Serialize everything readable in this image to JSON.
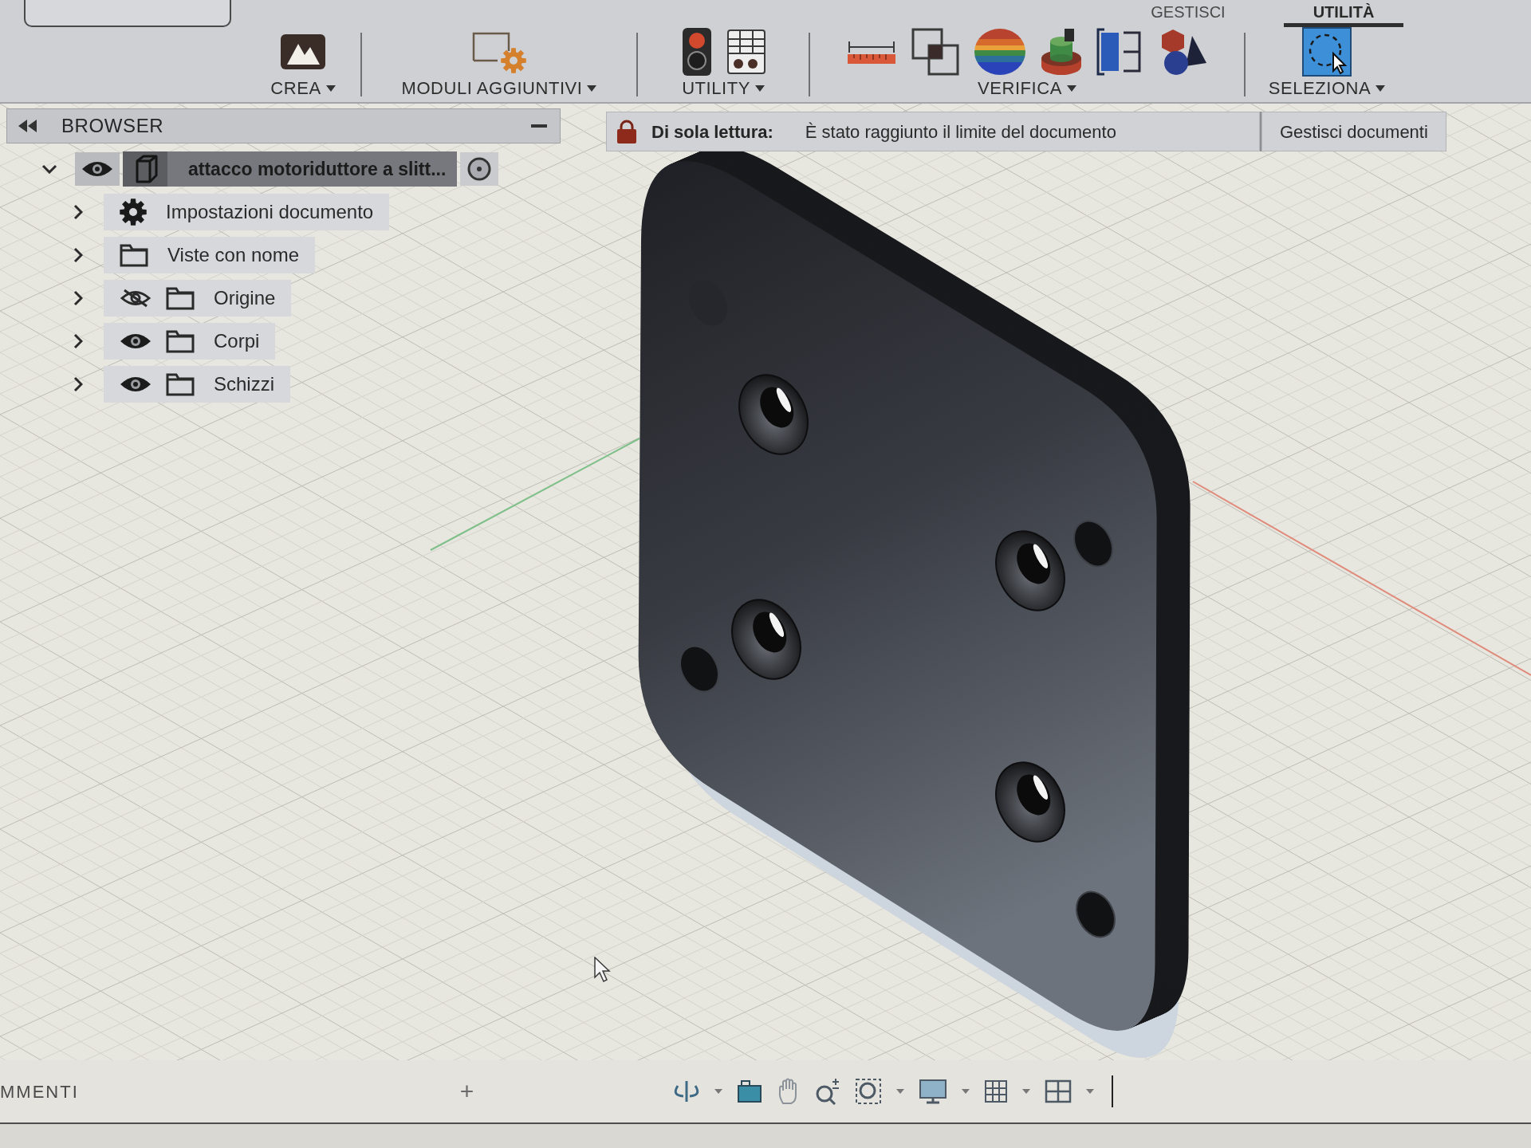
{
  "toolbar": {
    "tabs": [
      {
        "label": "GESTISCI",
        "selected": false
      },
      {
        "label": "UTILITÀ",
        "selected": true
      }
    ],
    "groups": [
      {
        "kind": "create",
        "label": "CREA",
        "active": false
      },
      {
        "kind": "addins",
        "label": "MODULI AGGIUNTIVI",
        "active": false
      },
      {
        "kind": "utility",
        "label": "UTILITY",
        "active": false
      },
      {
        "kind": "inspect",
        "label": "VERIFICA",
        "active": false
      },
      {
        "kind": "select",
        "label": "SELEZIONA",
        "active": true
      }
    ]
  },
  "browser": {
    "title": "BROWSER",
    "tree": [
      {
        "label": "attacco motoriduttore a slitt...",
        "kind": "component",
        "expanded": true,
        "visible": true,
        "selected": true,
        "children": [
          {
            "label": "Impostazioni documento",
            "kind": "settings",
            "expanded": false,
            "selected": false
          },
          {
            "label": "Viste con nome",
            "kind": "folder",
            "expanded": false,
            "selected": false
          },
          {
            "label": "Origine",
            "kind": "folder",
            "expanded": false,
            "visible": false,
            "selected": false
          },
          {
            "label": "Corpi",
            "kind": "folder",
            "expanded": false,
            "visible": true,
            "selected": false
          },
          {
            "label": "Schizzi",
            "kind": "folder",
            "expanded": false,
            "visible": true,
            "selected": false
          }
        ]
      }
    ]
  },
  "banner": {
    "title": "Di sola lettura:",
    "message": "È stato raggiunto il limite del documento",
    "button": "Gestisci documenti"
  },
  "navigation_bar": {
    "comments_label": "MMENTI",
    "add_button": "+"
  }
}
